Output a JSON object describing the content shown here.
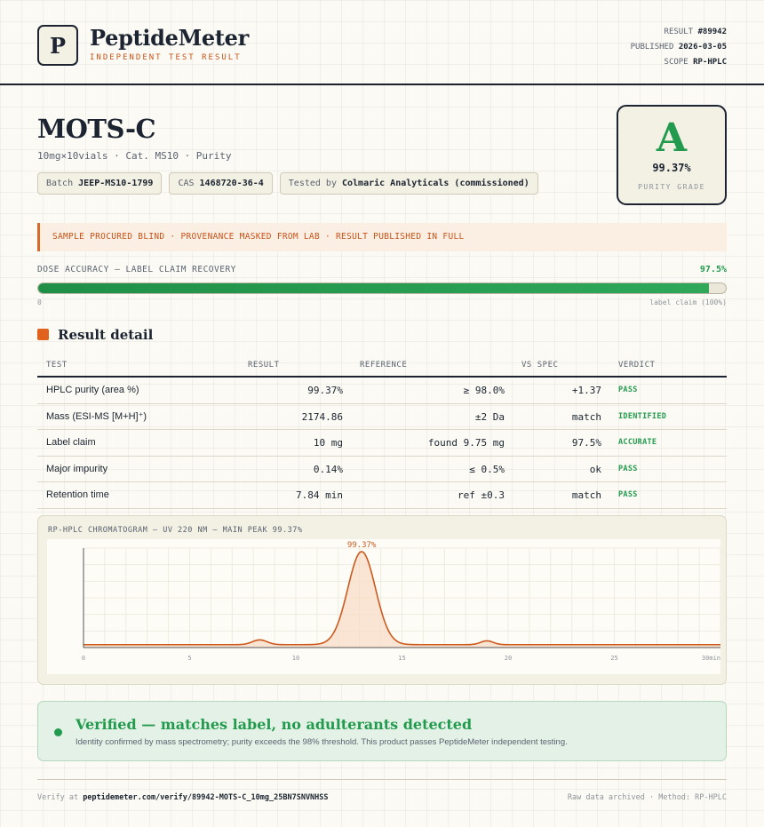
{
  "brand": {
    "logo_letter": "P",
    "name": "PeptideMeter",
    "subtitle": "INDEPENDENT TEST RESULT"
  },
  "meta": {
    "result_label": "RESULT",
    "result_value": "#89942",
    "published_label": "PUBLISHED",
    "published_value": "2026-03-05",
    "scope_label": "SCOPE",
    "scope_value": "RP-HPLC"
  },
  "product": {
    "name": "MOTS-C",
    "subtitle": "10mg×10vials · Cat. MS10 · Purity",
    "batch_label": "Batch",
    "batch_value": "JEEP-MS10-1799",
    "cas_label": "CAS",
    "cas_value": "1468720-36-4",
    "tested_label": "Tested by",
    "tested_value": "Colmaric Analyticals (commissioned)"
  },
  "grade": {
    "letter": "A",
    "value": "99.37%",
    "label": "PURITY GRADE"
  },
  "notice": "SAMPLE PROCURED BLIND · PROVENANCE MASKED FROM LAB · RESULT PUBLISHED IN FULL",
  "dose": {
    "label": "DOSE ACCURACY — LABEL CLAIM RECOVERY",
    "value_text": "97.5%",
    "fraction": 0.975,
    "min_label": "0",
    "max_label": "label claim (100%)"
  },
  "section_title": "Result detail",
  "table": {
    "headers": [
      "TEST",
      "RESULT",
      "REFERENCE",
      "VS SPEC",
      "VERDICT"
    ],
    "rows": [
      {
        "test": "HPLC purity (area %)",
        "result": "99.37%",
        "reference": "≥ 98.0%",
        "vs": "+1.37",
        "verdict": "PASS"
      },
      {
        "test": "Mass (ESI-MS [M+H]⁺)",
        "result": "2174.86",
        "reference": "±2 Da",
        "vs": "match",
        "verdict": "IDENTIFIED"
      },
      {
        "test": "Label claim",
        "result": "10 mg",
        "reference": "found 9.75 mg",
        "vs": "97.5%",
        "verdict": "ACCURATE"
      },
      {
        "test": "Major impurity",
        "result": "0.14%",
        "reference": "≤ 0.5%",
        "vs": "ok",
        "verdict": "PASS"
      },
      {
        "test": "Retention time",
        "result": "7.84 min",
        "reference": "ref ±0.3",
        "vs": "match",
        "verdict": "PASS"
      }
    ]
  },
  "chart_data": {
    "type": "line",
    "title": "RP-HPLC CHROMATOGRAM — UV 220 NM — MAIN PEAK 99.37%",
    "xlabel": "",
    "ylabel": "",
    "xlim": [
      0,
      30
    ],
    "x_ticks": [
      "0",
      "5",
      "10",
      "15",
      "20",
      "25",
      "30"
    ],
    "x_unit_label": "min",
    "baseline": 0.03,
    "peaks": [
      {
        "x": 8.3,
        "height": 0.05,
        "width": 0.35
      },
      {
        "x": 13.1,
        "height": 0.97,
        "width": 0.65,
        "label": "99.37%"
      },
      {
        "x": 19.0,
        "height": 0.04,
        "width": 0.3
      }
    ],
    "grid": true,
    "line_color": "#cc5a1e",
    "fill_color": "#f8dcc5"
  },
  "verified": {
    "title": "Verified — matches label, no adulterants detected",
    "text": "Identity confirmed by mass spectrometry; purity exceeds the 98% threshold. This product passes PeptideMeter independent testing."
  },
  "footer": {
    "verify_prefix": "Verify at",
    "verify_url": "peptidemeter.com/verify/89942-MOTS-C_10mg_25BN7SNVNHSS",
    "right": "Raw data archived · Method: RP-HPLC"
  },
  "colors": {
    "accent_orange": "#e0621c",
    "pass_green": "#239b4e",
    "ink": "#1b2430"
  }
}
